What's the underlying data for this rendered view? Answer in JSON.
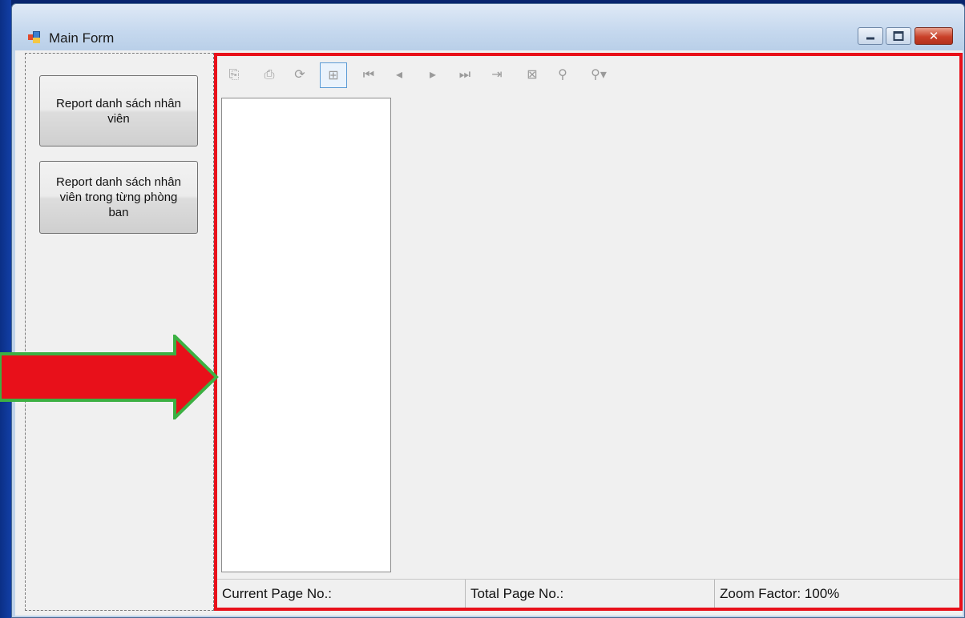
{
  "window": {
    "title": "Main Form",
    "close_glyph": "✕"
  },
  "buttons": [
    {
      "label": "Report danh sách nhân\nviên"
    },
    {
      "label": "Report danh sách nhân\nviên trong từng phòng\nban"
    }
  ],
  "toolbar": {
    "icons": [
      "export-icon",
      "print-icon",
      "refresh-icon",
      "group-tree-icon",
      "first-page-icon",
      "previous-page-icon",
      "next-page-icon",
      "last-page-icon",
      "goto-page-icon",
      "stop-icon",
      "search-icon",
      "zoom-icon"
    ],
    "glyphs": {
      "export": "⎘",
      "print": "⎙",
      "refresh": "⟳",
      "tree": "⊞",
      "first": "⏮",
      "prev": "◂",
      "next": "▸",
      "last": "⏭",
      "goto": "⇥",
      "stop": "⊠",
      "search": "⚲",
      "zoom": "⚲▾"
    }
  },
  "status": {
    "current_page": "Current Page No.:",
    "total_page": "Total Page No.:",
    "zoom": "Zoom Factor: 100%"
  },
  "colors": {
    "highlight": "#e8101a",
    "arrow": "#e8101a",
    "arrow_outline": "#3cb043",
    "background": "#0a2a7a"
  }
}
